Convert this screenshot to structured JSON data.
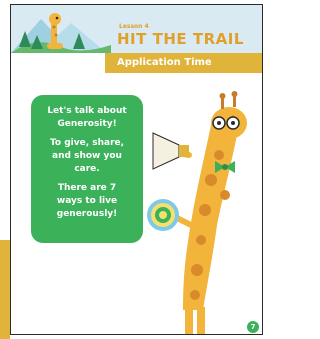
{
  "header": {
    "lesson": "Lesson 4",
    "title": "HIT THE TRAIL",
    "banner": "Application Time"
  },
  "card": {
    "line1": "Let's talk about",
    "line2": "Generosity!",
    "line3": "To give, share,",
    "line4": "and show you",
    "line5": "care.",
    "line6": "There are 7",
    "line7": "ways to live",
    "line8": "generously!"
  },
  "page_number": "7",
  "colors": {
    "accent": "#e0b33a",
    "green": "#3bb15a",
    "sky": "#daeaf2"
  },
  "icons": [
    "giraffe-mascot-icon",
    "megaphone-icon",
    "pompom-icon",
    "tree-icon",
    "mountain-icon"
  ]
}
